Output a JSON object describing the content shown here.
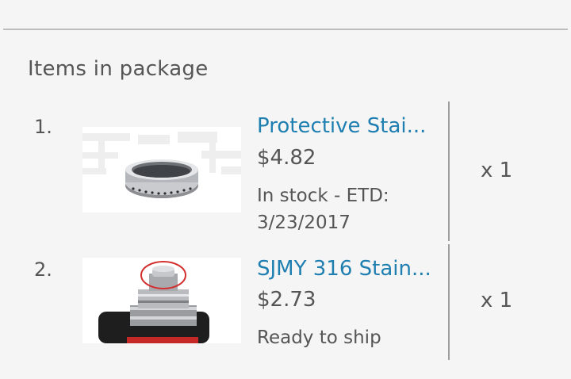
{
  "section_title": "Items in package",
  "items": [
    {
      "index": "1.",
      "title": "Protective Stai...",
      "price": "$4.82",
      "stock": "In stock - ETD: 3/23/2017",
      "quantity": "x 1",
      "image": "stainless-steel-ring-photo"
    },
    {
      "index": "2.",
      "title": "SJMY 316 Stain...",
      "price": "$2.73",
      "stock": "Ready to ship",
      "quantity": "x 1",
      "image": "atomizer-drip-tip-photo"
    }
  ],
  "colors": {
    "background": "#f5f5f5",
    "link": "#1f7fb0",
    "text": "#555555",
    "divider": "#bdbdbd"
  }
}
